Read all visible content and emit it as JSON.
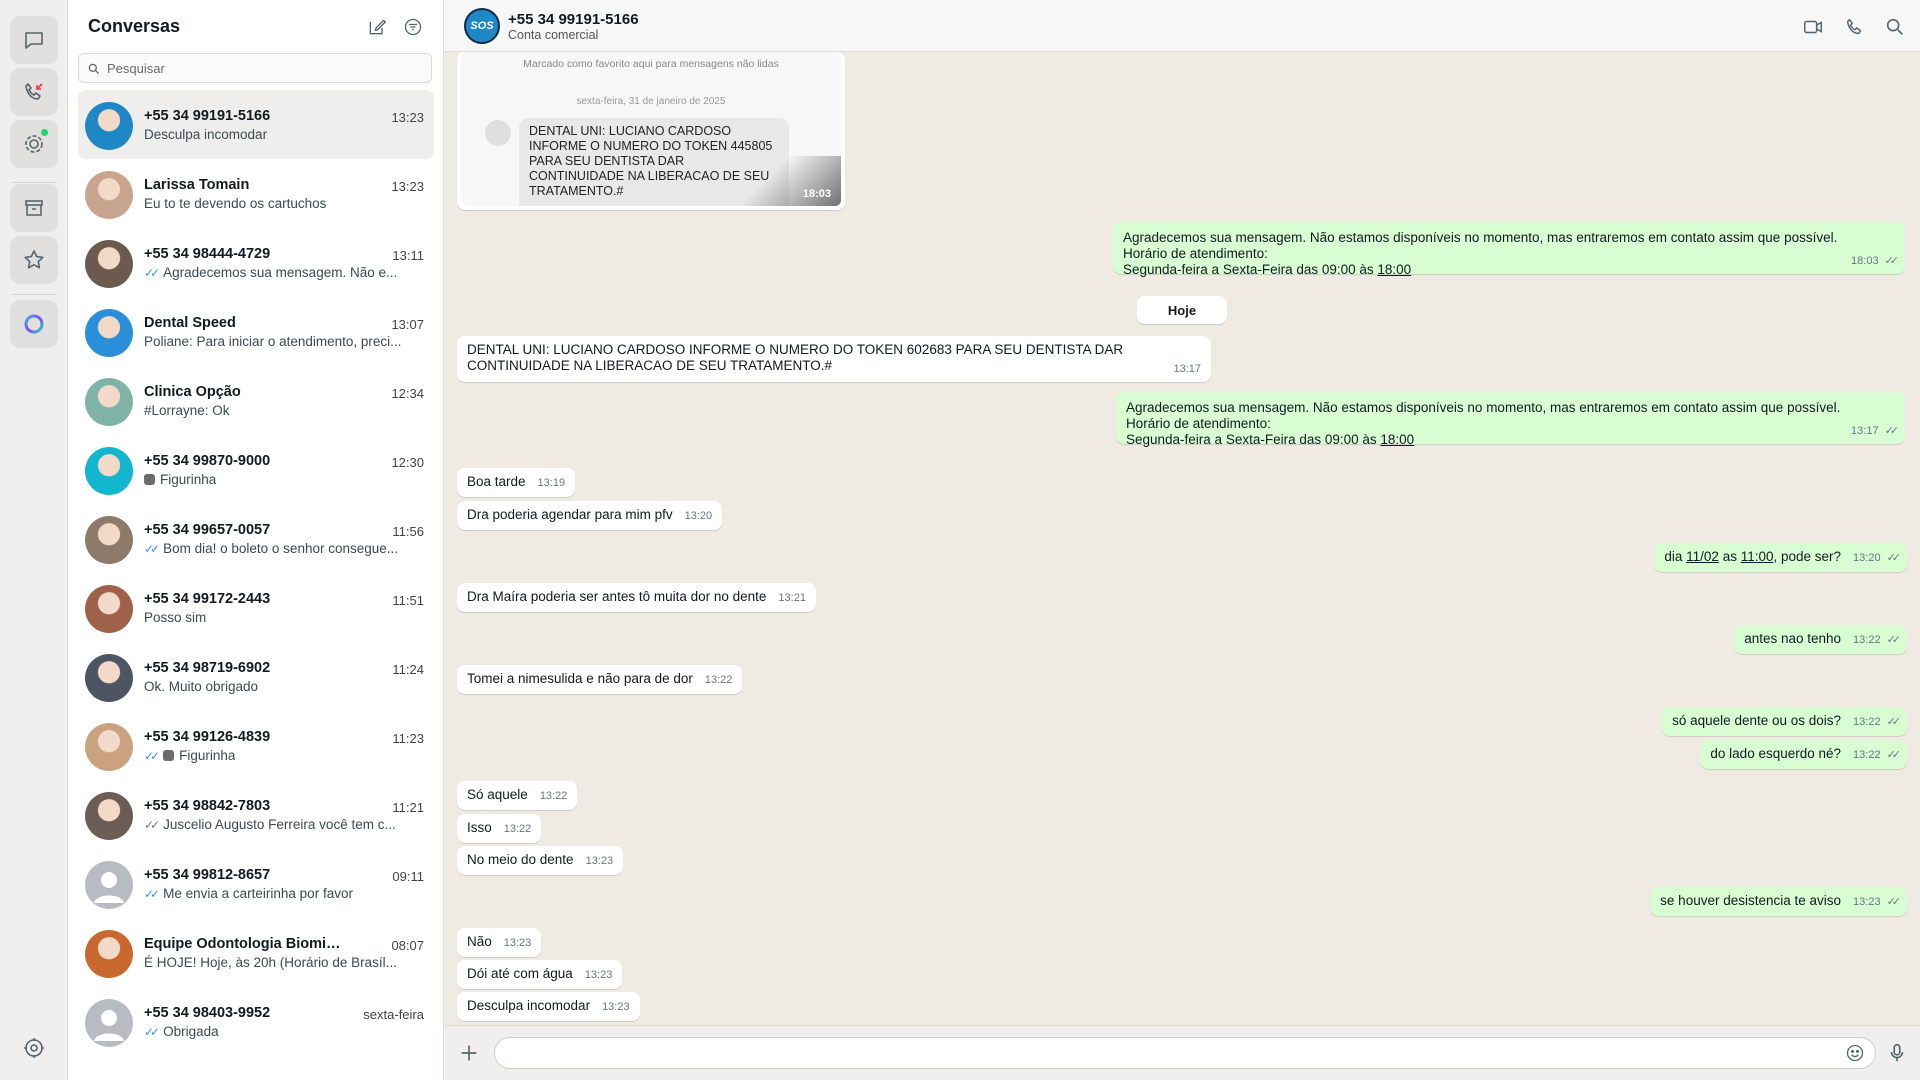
{
  "rail": {
    "icons": [
      "chats-icon",
      "calls-icon",
      "status-icon",
      "archive-icon",
      "starred-icon",
      "meta-ai-icon",
      "settings-icon"
    ]
  },
  "list": {
    "title": "Conversas",
    "search_placeholder": "Pesquisar",
    "chats": [
      {
        "name": "+55 34 99191-5166",
        "time": "13:23",
        "preview": "Desculpa incomodar",
        "ticks": "",
        "sticker": false,
        "avatar_color": "#1e88c7",
        "active": true
      },
      {
        "name": "Larissa Tomain",
        "time": "13:23",
        "preview": "Eu to te devendo os cartuchos",
        "ticks": "",
        "sticker": false,
        "avatar_color": "#c9a48f"
      },
      {
        "name": "+55 34 98444-4729",
        "time": "13:11",
        "preview": "Agradecemos sua mensagem. Não e...",
        "ticks": "blue",
        "sticker": false,
        "avatar_color": "#6d5a4e"
      },
      {
        "name": "Dental Speed",
        "time": "13:07",
        "preview": "Poliane: Para iniciar o atendimento, preci...",
        "ticks": "",
        "sticker": false,
        "avatar_color": "#2a8ed8"
      },
      {
        "name": "Clinica Opção",
        "time": "12:34",
        "preview": "#Lorrayne: Ok",
        "ticks": "",
        "sticker": false,
        "avatar_color": "#7fb3a8"
      },
      {
        "name": "+55 34 99870-9000",
        "time": "12:30",
        "preview": "Figurinha",
        "ticks": "",
        "sticker": true,
        "avatar_color": "#13b5cf"
      },
      {
        "name": "+55 34 99657-0057",
        "time": "11:56",
        "preview": "Bom dia! o boleto o senhor consegue...",
        "ticks": "blue",
        "sticker": false,
        "avatar_color": "#8d7a6a"
      },
      {
        "name": "+55 34 99172-2443",
        "time": "11:51",
        "preview": "Posso sim",
        "ticks": "",
        "sticker": false,
        "avatar_color": "#a0614a"
      },
      {
        "name": "+55 34 98719-6902",
        "time": "11:24",
        "preview": "Ok. Muito obrigado",
        "ticks": "",
        "sticker": false,
        "avatar_color": "#4d5563"
      },
      {
        "name": "+55 34 99126-4839",
        "time": "11:23",
        "preview": "Figurinha",
        "ticks": "blue",
        "sticker": true,
        "avatar_color": "#caa27f"
      },
      {
        "name": "+55 34 98842-7803",
        "time": "11:21",
        "preview": "Juscelio Augusto Ferreira você tem c...",
        "ticks": "gray",
        "sticker": false,
        "avatar_color": "#6b5c55"
      },
      {
        "name": "+55 34 99812-8657",
        "time": "09:11",
        "preview": "Me envia a carteirinha por favor",
        "ticks": "blue",
        "sticker": false,
        "avatar_color": "#b8bcc2",
        "placeholder": true
      },
      {
        "name": "Equipe Odontologia Biomimética",
        "time": "08:07",
        "preview": "É HOJE! Hoje, às 20h (Horário de Brasíl...",
        "ticks": "",
        "sticker": false,
        "avatar_color": "#c8672e"
      },
      {
        "name": "+55 34 98403-9952",
        "time": "sexta-feira",
        "preview": "Obrigada",
        "ticks": "blue",
        "sticker": false,
        "avatar_color": "#b8bcc2",
        "placeholder": true
      }
    ]
  },
  "header": {
    "name": "+55 34 99191-5166",
    "subtitle": "Conta comercial",
    "avatar_text": "SOS"
  },
  "image_message": {
    "fav_note": "Marcado como favorito aqui para mensagens não lidas",
    "date": "sexta-feira, 31 de janeiro de 2025",
    "text": "DENTAL UNI: LUCIANO CARDOSO INFORME O NUMERO DO TOKEN 445805 PARA SEU DENTISTA DAR CONTINUIDADE NA LIBERACAO DE SEU TRATAMENTO.#",
    "time": "18:03"
  },
  "auto_reply": {
    "line1": "Agradecemos sua mensagem. Não estamos disponíveis no momento, mas entraremos em contato assim que possível.",
    "line2": "Horário de atendimento:",
    "line3a": "Segunda-feira a Sexta-Feira das 09:00 às ",
    "line3b": "18:00"
  },
  "day_divider": "Hoje",
  "messages": {
    "m1_time": "18:03",
    "m2_text": "DENTAL UNI: LUCIANO CARDOSO INFORME O NUMERO DO TOKEN 602683 PARA SEU DENTISTA DAR CONTINUIDADE NA LIBERACAO DE SEU TRATAMENTO.#",
    "m2_time": "13:17",
    "m3_time": "13:17",
    "m4_text": "Boa tarde",
    "m4_time": "13:19",
    "m5_text": "Dra poderia agendar para mim pfv",
    "m5_time": "13:20",
    "m6_pre": "dia ",
    "m6_date": "11/02",
    "m6_mid": " as ",
    "m6_hour": "11:00",
    "m6_post": ", pode ser?",
    "m6_time": "13:20",
    "m7_text": "Dra Maíra poderia ser antes tô muita dor no dente",
    "m7_time": "13:21",
    "m8_text": "antes nao tenho",
    "m8_time": "13:22",
    "m9_text": "Tomei a nimesulida e não para de dor",
    "m9_time": "13:22",
    "m10_text": "só aquele dente ou os dois?",
    "m10_time": "13:22",
    "m11_text": "do lado esquerdo né?",
    "m11_time": "13:22",
    "m12_text": "Só aquele",
    "m12_time": "13:22",
    "m13_text": "Isso",
    "m13_time": "13:22",
    "m14_text": "No meio do dente",
    "m14_time": "13:23",
    "m15_text": "se houver desistencia te aviso",
    "m15_time": "13:23",
    "m16_text": "Não",
    "m16_time": "13:23",
    "m17_text": "Dói até com água",
    "m17_time": "13:23",
    "m18_text": "Desculpa incomodar",
    "m18_time": "13:23"
  },
  "composer": {
    "placeholder": ""
  }
}
